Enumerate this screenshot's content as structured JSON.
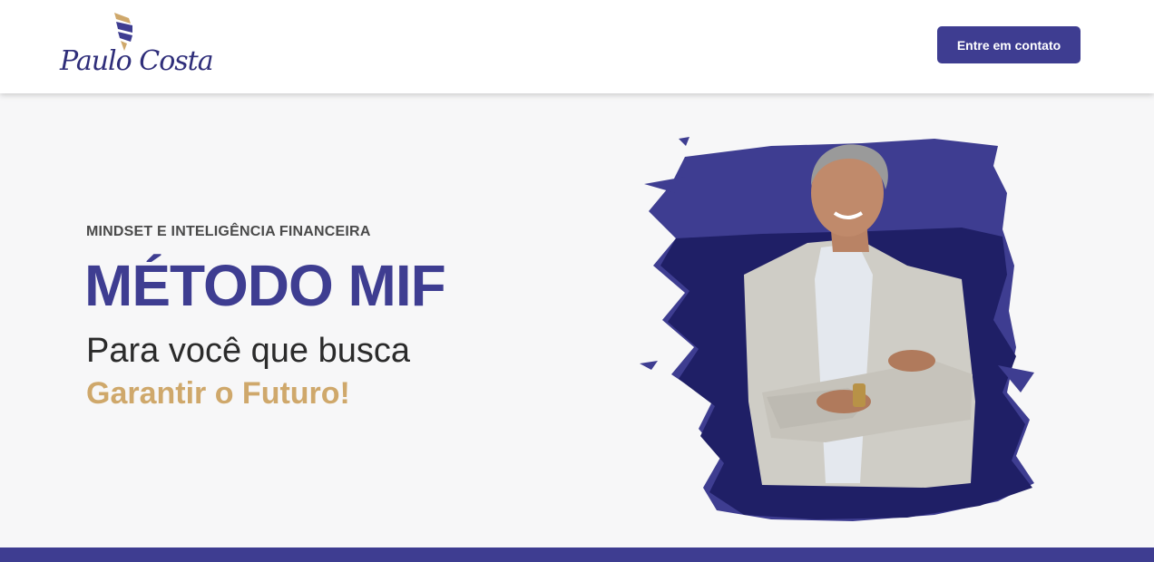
{
  "header": {
    "logo_text": "Paulo Costa",
    "cta_label": "Entre em contato"
  },
  "hero": {
    "eyebrow": "MINDSET E INTELIGÊNCIA FINANCEIRA",
    "title": "MÉTODO MIF",
    "subtitle": "Para você que busca",
    "highlight": "Garantir o Futuro!"
  },
  "colors": {
    "brand": "#3e3d91",
    "brand_dark": "#1f1f66",
    "accent_gold": "#cfa86b",
    "text_dark": "#2b2b2b",
    "background": "#f7f7f8"
  },
  "icons": {
    "logo_mark": "flame-pillar-icon"
  }
}
